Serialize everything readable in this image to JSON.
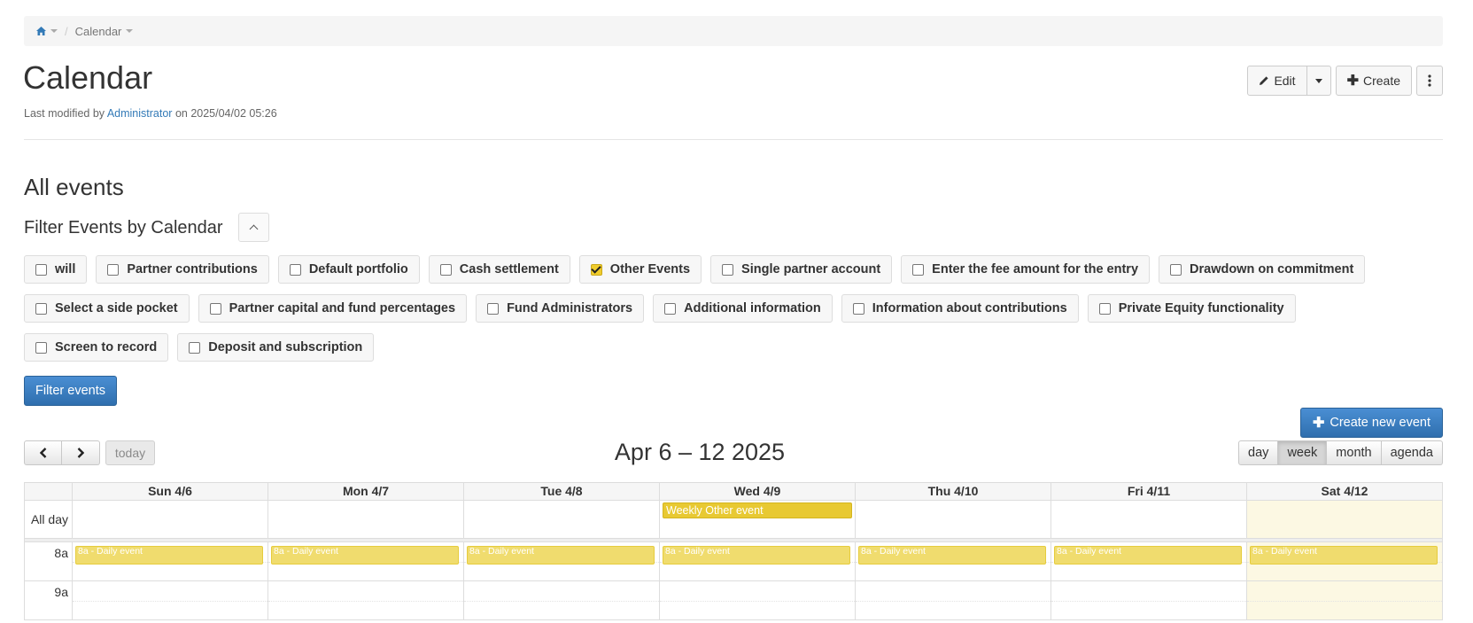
{
  "breadcrumb": {
    "home_icon": "home-icon",
    "current": "Calendar"
  },
  "page": {
    "title": "Calendar",
    "modified_prefix": "Last modified by",
    "modified_user": "Administrator",
    "modified_suffix": "on 2025/04/02 05:26"
  },
  "actions": {
    "edit_label": "Edit",
    "create_label": "Create"
  },
  "section_title": "All events",
  "filter": {
    "title": "Filter Events by Calendar",
    "button_label": "Filter events",
    "calendars": [
      [
        {
          "label": "will",
          "checked": false
        },
        {
          "label": "Partner contributions",
          "checked": false
        },
        {
          "label": "Default portfolio",
          "checked": false
        },
        {
          "label": "Cash settlement",
          "checked": false
        },
        {
          "label": "Other Events",
          "checked": true
        },
        {
          "label": "Single partner account",
          "checked": false
        },
        {
          "label": "Enter the fee amount for the entry",
          "checked": false
        },
        {
          "label": "Drawdown on commitment",
          "checked": false
        }
      ],
      [
        {
          "label": "Select a side pocket",
          "checked": false
        },
        {
          "label": "Partner capital and fund percentages",
          "checked": false
        },
        {
          "label": "Fund Administrators",
          "checked": false
        },
        {
          "label": "Additional information",
          "checked": false
        },
        {
          "label": "Information about contributions",
          "checked": false
        },
        {
          "label": "Private Equity functionality",
          "checked": false
        }
      ],
      [
        {
          "label": "Screen to record",
          "checked": false
        },
        {
          "label": "Deposit and subscription",
          "checked": false
        }
      ]
    ]
  },
  "calendar": {
    "create_event_label": "Create new event",
    "today_label": "today",
    "range_title": "Apr 6 – 12 2025",
    "views": [
      "day",
      "week",
      "month",
      "agenda"
    ],
    "active_view": "week",
    "days": [
      "Sun 4/6",
      "Mon 4/7",
      "Tue 4/8",
      "Wed 4/9",
      "Thu 4/10",
      "Fri 4/11",
      "Sat 4/12"
    ],
    "today_index": 6,
    "allday_label": "All day",
    "allday_event": {
      "day_index": 3,
      "label": "Weekly Other event"
    },
    "time_rows": [
      "8a",
      "9a"
    ],
    "daily_event_label": "8a - Daily event",
    "event_color": "#f0dc6e"
  }
}
